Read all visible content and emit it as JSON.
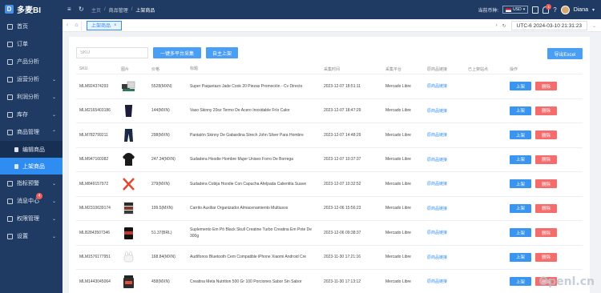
{
  "app": {
    "logo_letter": "D",
    "name": "多麦BI"
  },
  "sidebar": {
    "items": [
      {
        "label": "首页",
        "icon": "home-icon",
        "arrow": ""
      },
      {
        "label": "订单",
        "icon": "order-icon",
        "arrow": ""
      },
      {
        "label": "产品分析",
        "icon": "product-analysis-icon",
        "arrow": ""
      },
      {
        "label": "运营分析",
        "icon": "operation-icon",
        "arrow": "⌄"
      },
      {
        "label": "利润分析",
        "icon": "profit-icon",
        "arrow": "⌄"
      },
      {
        "label": "库存",
        "icon": "inventory-icon",
        "arrow": "⌄"
      },
      {
        "label": "商品管理",
        "icon": "goods-icon",
        "arrow": "⌃"
      }
    ],
    "sub_items": [
      {
        "label": "编辑商品"
      },
      {
        "label": "上架商品"
      }
    ],
    "items_after": [
      {
        "label": "指标预警",
        "icon": "alert-icon",
        "arrow": "⌄"
      },
      {
        "label": "消息中心",
        "icon": "message-icon",
        "arrow": "⌄",
        "badge": "4"
      },
      {
        "label": "权限管理",
        "icon": "permission-icon",
        "arrow": "⌄"
      },
      {
        "label": "设置",
        "icon": "settings-icon",
        "arrow": "⌄"
      }
    ]
  },
  "topbar": {
    "breadcrumb": [
      "主页",
      "商品管理",
      "上架商品"
    ],
    "currency_label": "当前币种:",
    "currency": "USD",
    "bell_badge": "1",
    "user_name": "Diana"
  },
  "tabbar": {
    "tab_label": "上架商品",
    "timezone_clock": "UTC-6 2024-03-10 21:31:23"
  },
  "toolbar": {
    "sku_placeholder": "SKU",
    "btn_collect": "一键多平台采集",
    "btn_publish": "自主上架",
    "btn_export": "导出Excel"
  },
  "table": {
    "headers": [
      "SKU",
      "图片",
      "价格",
      "标题",
      "采集时间",
      "采集平台",
      "原商品链接",
      "已上架站点",
      "操作"
    ],
    "rows": [
      {
        "sku": "MLM924374293",
        "price": "5528(MXN)",
        "title": "Super Paquetazo Jade Cook 20 Piezas Promoción - Cv Directo",
        "time": "2023-12-07 18:51:11",
        "platform": "Mercado Libre",
        "link": "原商品链接",
        "site": "",
        "img": "cookware"
      },
      {
        "sku": "MLM2165403186",
        "price": "144(MXN)",
        "title": "Vaso Skinny 20oz Termo De Acero Inoxidable Frío Calor",
        "time": "2023-12-07 18:47:29",
        "platform": "Mercado Libre",
        "link": "原商品链接",
        "site": "",
        "img": "tumbler"
      },
      {
        "sku": "MLM782799211",
        "price": "298(MXN)",
        "title": "Pantalón Skinny De Gabardina Strech John Silver Para Hombre",
        "time": "2023-12-07 14:48:29",
        "platform": "Mercado Libre",
        "link": "原商品链接",
        "site": "",
        "img": "pants"
      },
      {
        "sku": "MLM947160382",
        "price": "247.34(MXN)",
        "title": "Sudadera Hoodie Hombre Mujer Unisex Forro De Borrega",
        "time": "2023-12-07 10:37:37",
        "platform": "Mercado Libre",
        "link": "原商品链接",
        "site": "",
        "img": "hoodie"
      },
      {
        "sku": "MLM849157972",
        "price": "279(MXN)",
        "title": "Sudadera Cobija Hoodie Con Capucha Afelpada Calientita Suave",
        "time": "2023-12-07 10:32:52",
        "platform": "Mercado Libre",
        "link": "原商品链接",
        "site": "",
        "img": "missing"
      },
      {
        "sku": "MLM2310639174",
        "price": "199.5(MXN)",
        "title": "Carrito Auxiliar Organizador Almacenamiento Multiusos",
        "time": "2023-12-06 15:56:23",
        "platform": "Mercado Libre",
        "link": "原商品链接",
        "site": "",
        "img": "cart"
      },
      {
        "sku": "MLB2843507346",
        "price": "51.37(BRL)",
        "title": "Suplemento Em Pó Black Skull Creatine Turbo Creatina Em Pote De 300g",
        "time": "2023-12-06 09:38:37",
        "platform": "Mercado Libre",
        "link": "原商品链接",
        "site": "",
        "img": "supplement"
      },
      {
        "sku": "MLM1576177951",
        "price": "168.84(MXN)",
        "title": "Audífonos Bluetooth Cem Compatible iPhone Xiaomi Android Cre",
        "time": "2023-11-30 17:21:16",
        "platform": "Mercado Libre",
        "link": "原商品链接",
        "site": "",
        "img": "earbuds"
      },
      {
        "sku": "MLM1443045064",
        "price": "458(MXN)",
        "title": "Creatina Meta Nutrition 500 Gr 100 Porciones Sabor Sin Sabor",
        "time": "2023-11-30 17:13:12",
        "platform": "Mercado Libre",
        "link": "原商品链接",
        "site": "",
        "img": "jar"
      }
    ],
    "op_publish": "上架",
    "op_delete": "删除"
  },
  "watermark": "Openl.cn"
}
